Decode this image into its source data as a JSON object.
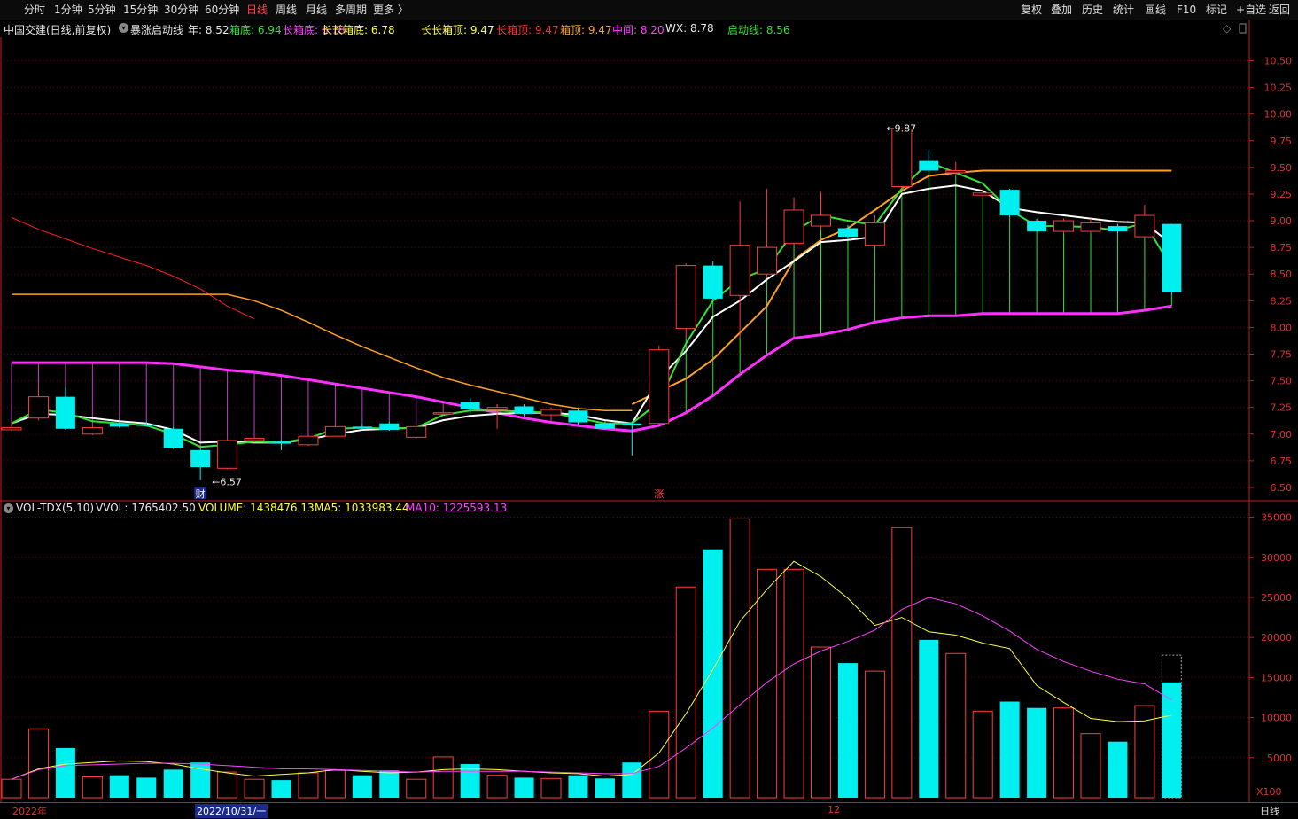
{
  "toolbar": {
    "periods": [
      "分时",
      "1分钟",
      "5分钟",
      "15分钟",
      "30分钟",
      "60分钟",
      "日线",
      "周线",
      "月线",
      "多周期",
      "更多 〉"
    ],
    "active_period": "日线",
    "tools": [
      "复权",
      "叠加",
      "历史",
      "统计",
      "画线",
      "F10",
      "标记",
      "+自选",
      "返回"
    ]
  },
  "info": {
    "stock_title": "中国交建(日线,前复权)",
    "indicator": "暴涨启动线",
    "items": [
      {
        "label": "年:",
        "value": "8.52",
        "color": "#e8e8e8"
      },
      {
        "label": "箱底:",
        "value": "6.94",
        "color": "#33e233"
      },
      {
        "label": "长箱底:",
        "value": "6.78",
        "color": "#ff40ff"
      },
      {
        "label": "长长箱底:",
        "value": "6.78",
        "color": "#ffff40"
      },
      {
        "label": "长长箱顶:",
        "value": "9.47",
        "color": "#ffff40"
      },
      {
        "label": "长箱顶:",
        "value": "9.47",
        "color": "#ff3030"
      },
      {
        "label": "箱顶:",
        "value": "9.47",
        "color": "#ffa020"
      },
      {
        "label": "中间:",
        "value": "8.20",
        "color": "#ff40ff"
      },
      {
        "label": "WX:",
        "value": "8.78",
        "color": "#e8e8e8"
      },
      {
        "label": "启动线:",
        "value": "8.56",
        "color": "#33e233"
      }
    ]
  },
  "volinfo": {
    "name": "VOL-TDX(5,10)",
    "items": [
      {
        "label": "VVOL:",
        "value": "1765402.50",
        "color": "#e8e8e8"
      },
      {
        "label": "VOLUME:",
        "value": "1438476.13",
        "color": "#ffff40"
      },
      {
        "label": "MA5:",
        "value": "1033983.44",
        "color": "#ffff40"
      },
      {
        "label": "MA10:",
        "value": "1225593.13",
        "color": "#ff40ff"
      }
    ]
  },
  "bottom": {
    "year": "2022年",
    "cursor_date": "2022/10/31/一",
    "month": "12",
    "unit": "X100",
    "period_label": "日线"
  },
  "colors": {
    "up": "#ff3b3b",
    "down": "#00f0f0",
    "ma": "#ffffff",
    "ma_fast": "#33e233",
    "ma_slow": "#ffa020",
    "box_mid": "#ff30ff",
    "line_long": "#ff2020",
    "grid": "#6a0000"
  },
  "chart_data": {
    "type": "candlestick",
    "price_axis": {
      "ticks": [
        6.5,
        6.75,
        7.0,
        7.25,
        7.5,
        7.75,
        8.0,
        8.25,
        8.5,
        8.75,
        9.0,
        9.25,
        9.5,
        9.75,
        10.0,
        10.25,
        10.5
      ],
      "ylim": [
        6.4,
        10.72
      ]
    },
    "volume_axis": {
      "ticks": [
        5000,
        10000,
        15000,
        20000,
        25000,
        30000,
        35000
      ],
      "ylim": [
        0,
        36500
      ],
      "unit": "X100"
    },
    "annotations": [
      {
        "text": "9.87",
        "bar": 32,
        "price": 9.87
      },
      {
        "text": "6.57",
        "bar": 7,
        "price": 6.57
      }
    ],
    "markers": [
      {
        "text": "财",
        "bar": 7
      },
      {
        "text": "涨",
        "bar": 24
      }
    ],
    "candles": [
      {
        "o": 7.04,
        "c": 7.06,
        "h": 7.11,
        "l": 7.03,
        "v": 2300
      },
      {
        "o": 7.15,
        "c": 7.35,
        "h": 7.44,
        "l": 7.13,
        "v": 8600
      },
      {
        "o": 7.35,
        "c": 7.05,
        "h": 7.44,
        "l": 7.04,
        "v": 6200
      },
      {
        "o": 7.0,
        "c": 7.06,
        "h": 7.09,
        "l": 6.99,
        "v": 2600
      },
      {
        "o": 7.1,
        "c": 7.07,
        "h": 7.12,
        "l": 7.06,
        "v": 2800
      },
      {
        "o": 7.09,
        "c": 7.08,
        "h": 7.12,
        "l": 7.07,
        "v": 2500
      },
      {
        "o": 7.05,
        "c": 6.87,
        "h": 7.07,
        "l": 6.86,
        "v": 3500
      },
      {
        "o": 6.85,
        "c": 6.69,
        "h": 6.87,
        "l": 6.57,
        "v": 4400
      },
      {
        "o": 6.68,
        "c": 6.94,
        "h": 6.95,
        "l": 6.67,
        "v": 3200
      },
      {
        "o": 6.94,
        "c": 6.96,
        "h": 6.97,
        "l": 6.92,
        "v": 2300
      },
      {
        "o": 6.93,
        "c": 6.91,
        "h": 6.95,
        "l": 6.85,
        "v": 2200
      },
      {
        "o": 6.9,
        "c": 6.98,
        "h": 6.99,
        "l": 6.89,
        "v": 3100
      },
      {
        "o": 6.98,
        "c": 7.07,
        "h": 7.1,
        "l": 6.98,
        "v": 3400
      },
      {
        "o": 7.07,
        "c": 7.06,
        "h": 7.1,
        "l": 7.04,
        "v": 2800
      },
      {
        "o": 7.1,
        "c": 7.04,
        "h": 7.12,
        "l": 7.03,
        "v": 3400
      },
      {
        "o": 6.97,
        "c": 7.07,
        "h": 7.08,
        "l": 6.96,
        "v": 2300
      },
      {
        "o": 7.2,
        "c": 7.2,
        "h": 7.23,
        "l": 7.18,
        "v": 5100
      },
      {
        "o": 7.3,
        "c": 7.23,
        "h": 7.34,
        "l": 7.19,
        "v": 4200
      },
      {
        "o": 7.23,
        "c": 7.25,
        "h": 7.28,
        "l": 7.05,
        "v": 2800
      },
      {
        "o": 7.26,
        "c": 7.19,
        "h": 7.28,
        "l": 7.17,
        "v": 2500
      },
      {
        "o": 7.18,
        "c": 7.23,
        "h": 7.25,
        "l": 7.16,
        "v": 2400
      },
      {
        "o": 7.22,
        "c": 7.11,
        "h": 7.23,
        "l": 7.09,
        "v": 2800
      },
      {
        "o": 7.1,
        "c": 7.05,
        "h": 7.12,
        "l": 7.04,
        "v": 2400
      },
      {
        "o": 7.1,
        "c": 7.08,
        "h": 7.12,
        "l": 6.8,
        "v": 4400
      },
      {
        "o": 7.1,
        "c": 7.79,
        "h": 7.83,
        "l": 7.08,
        "v": 10800
      },
      {
        "o": 7.99,
        "c": 8.58,
        "h": 8.6,
        "l": 7.9,
        "v": 26300
      },
      {
        "o": 8.58,
        "c": 8.27,
        "h": 8.62,
        "l": 8.26,
        "v": 31000
      },
      {
        "o": 8.3,
        "c": 8.77,
        "h": 9.18,
        "l": 7.91,
        "v": 34800
      },
      {
        "o": 8.5,
        "c": 8.75,
        "h": 9.3,
        "l": 8.46,
        "v": 28500
      },
      {
        "o": 8.79,
        "c": 9.1,
        "h": 9.22,
        "l": 8.78,
        "v": 28500
      },
      {
        "o": 8.95,
        "c": 9.05,
        "h": 9.27,
        "l": 8.92,
        "v": 18800
      },
      {
        "o": 8.93,
        "c": 8.85,
        "h": 8.96,
        "l": 8.83,
        "v": 16800
      },
      {
        "o": 8.77,
        "c": 8.98,
        "h": 9.05,
        "l": 8.76,
        "v": 15800
      },
      {
        "o": 9.32,
        "c": 9.86,
        "h": 9.87,
        "l": 9.3,
        "v": 33700
      },
      {
        "o": 9.56,
        "c": 9.47,
        "h": 9.66,
        "l": 9.46,
        "v": 19700
      },
      {
        "o": 9.45,
        "c": 9.47,
        "h": 9.55,
        "l": 9.42,
        "v": 18000
      },
      {
        "o": 9.24,
        "c": 9.26,
        "h": 9.3,
        "l": 9.22,
        "v": 10800
      },
      {
        "o": 9.29,
        "c": 9.05,
        "h": 9.3,
        "l": 9.03,
        "v": 12000
      },
      {
        "o": 9.0,
        "c": 8.9,
        "h": 9.02,
        "l": 8.89,
        "v": 11200
      },
      {
        "o": 8.9,
        "c": 9.0,
        "h": 9.02,
        "l": 8.88,
        "v": 11200
      },
      {
        "o": 8.9,
        "c": 8.98,
        "h": 9.02,
        "l": 8.88,
        "v": 8000
      },
      {
        "o": 8.95,
        "c": 8.9,
        "h": 8.97,
        "l": 8.88,
        "v": 7000
      },
      {
        "o": 8.85,
        "c": 9.05,
        "h": 9.15,
        "l": 8.83,
        "v": 11500
      },
      {
        "o": 8.97,
        "c": 8.33,
        "h": 8.97,
        "l": 8.3,
        "v": 14400,
        "vghost": 17800
      }
    ],
    "series": [
      {
        "name": "年",
        "values": [
          null,
          null,
          null,
          null,
          null,
          null,
          null,
          null,
          null,
          null,
          null,
          null,
          null,
          null,
          null,
          null,
          null,
          null,
          null,
          null,
          null,
          null,
          null,
          null,
          null,
          null,
          null,
          null,
          null,
          null,
          null,
          null,
          null,
          null,
          null,
          null,
          null,
          null,
          null,
          null,
          null,
          null,
          null,
          null
        ]
      },
      {
        "name": "启动线",
        "values": [
          7.1,
          7.23,
          7.2,
          7.12,
          7.1,
          7.08,
          7.0,
          6.88,
          6.9,
          6.93,
          6.92,
          6.96,
          7.05,
          7.06,
          7.05,
          7.06,
          7.18,
          7.22,
          7.22,
          7.21,
          7.2,
          7.15,
          7.1,
          7.1,
          7.3,
          7.85,
          8.25,
          8.45,
          8.55,
          8.9,
          9.05,
          9.0,
          8.96,
          9.3,
          9.55,
          9.45,
          9.35,
          9.1,
          8.95,
          8.95,
          8.94,
          8.91,
          8.98,
          8.56
        ]
      },
      {
        "name": "WX",
        "values": [
          7.1,
          7.19,
          7.18,
          7.15,
          7.12,
          7.1,
          7.04,
          6.92,
          6.93,
          6.92,
          6.92,
          6.95,
          7.0,
          7.04,
          7.05,
          7.06,
          7.13,
          7.17,
          7.19,
          7.2,
          7.2,
          7.18,
          7.13,
          7.1,
          7.52,
          7.78,
          8.1,
          8.25,
          8.45,
          8.62,
          8.8,
          8.82,
          8.85,
          9.25,
          9.3,
          9.33,
          9.28,
          9.12,
          9.08,
          9.05,
          9.02,
          8.99,
          8.98,
          8.78
        ]
      },
      {
        "name": "箱顶",
        "values": [
          null,
          null,
          null,
          null,
          null,
          null,
          null,
          null,
          null,
          null,
          null,
          null,
          null,
          null,
          null,
          null,
          null,
          null,
          null,
          null,
          null,
          null,
          null,
          7.28,
          7.4,
          7.52,
          7.7,
          7.95,
          8.2,
          8.63,
          8.82,
          8.93,
          9.1,
          9.28,
          9.42,
          9.45,
          9.47,
          9.47,
          9.47,
          9.47,
          9.47,
          9.47,
          9.47,
          9.47
        ]
      },
      {
        "name": "中间",
        "values": [
          7.67,
          7.67,
          7.67,
          7.67,
          7.67,
          7.67,
          7.66,
          7.63,
          7.6,
          7.58,
          7.55,
          7.51,
          7.47,
          7.43,
          7.39,
          7.35,
          7.3,
          7.25,
          7.2,
          7.15,
          7.11,
          7.08,
          7.05,
          7.03,
          7.08,
          7.2,
          7.36,
          7.56,
          7.74,
          7.9,
          7.93,
          7.98,
          8.05,
          8.09,
          8.11,
          8.11,
          8.13,
          8.13,
          8.13,
          8.13,
          8.13,
          8.13,
          8.16,
          8.2
        ]
      },
      {
        "name": "长箱顶",
        "values": [
          9.03,
          8.92,
          8.83,
          8.74,
          8.66,
          8.58,
          8.48,
          8.36,
          8.2,
          8.08,
          null,
          null,
          null,
          null,
          null,
          null,
          null,
          null,
          null,
          null,
          null,
          null,
          null,
          null,
          null,
          null,
          null,
          null,
          null,
          null,
          null,
          null,
          null,
          null,
          null,
          null,
          null,
          null,
          null,
          null,
          null,
          null,
          null,
          null
        ]
      },
      {
        "name": "长长箱顶",
        "values": [
          8.31,
          8.31,
          8.31,
          8.31,
          8.31,
          8.31,
          8.31,
          8.31,
          8.31,
          8.25,
          8.16,
          8.05,
          7.93,
          7.82,
          7.72,
          7.62,
          7.53,
          7.46,
          7.4,
          7.34,
          7.28,
          7.24,
          7.22,
          7.22,
          null,
          null,
          null,
          null,
          null,
          null,
          null,
          null,
          null,
          null,
          null,
          null,
          null,
          null,
          null,
          null,
          null,
          null,
          null,
          null
        ]
      },
      {
        "name": "MA5",
        "values": [
          2300,
          3600,
          4200,
          4400,
          4600,
          4500,
          4200,
          3600,
          3100,
          2700,
          2900,
          3100,
          3500,
          3300,
          3100,
          3200,
          3500,
          3600,
          3500,
          3300,
          3100,
          3000,
          2700,
          2900,
          5600,
          10500,
          16000,
          22000,
          26000,
          29500,
          27600,
          24900,
          21500,
          22500,
          20700,
          20300,
          19300,
          18600,
          14000,
          11900,
          9900,
          9500,
          9600,
          10300
        ]
      },
      {
        "name": "MA10",
        "values": [
          2300,
          3500,
          4000,
          4100,
          4200,
          4300,
          4300,
          4200,
          4000,
          3800,
          3600,
          3600,
          3500,
          3400,
          3300,
          3200,
          3300,
          3300,
          3300,
          3300,
          3200,
          3100,
          3000,
          3000,
          3900,
          6200,
          8700,
          11600,
          14400,
          16700,
          18300,
          19500,
          20900,
          23500,
          25000,
          24200,
          22700,
          20800,
          18500,
          17000,
          15800,
          14800,
          14200,
          12200
        ]
      }
    ]
  }
}
